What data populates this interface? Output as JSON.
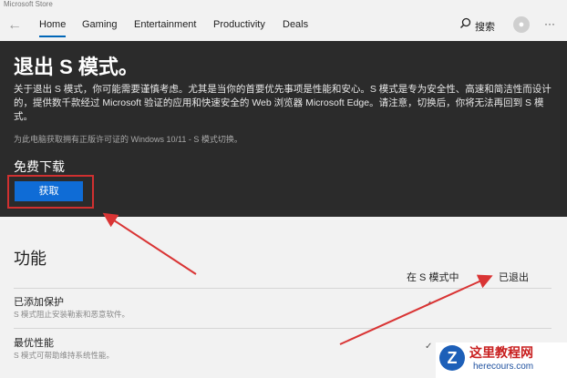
{
  "window": {
    "title": "Microsoft Store"
  },
  "nav": {
    "items": [
      {
        "label": "Home",
        "active": true
      },
      {
        "label": "Gaming"
      },
      {
        "label": "Entertainment"
      },
      {
        "label": "Productivity"
      },
      {
        "label": "Deals"
      }
    ],
    "search_label": "搜索",
    "more_label": "···",
    "icons": [
      "back-arrow-icon",
      "search-icon",
      "user-avatar-icon",
      "more-icon"
    ]
  },
  "hero": {
    "title": "退出 S 模式。",
    "description": "关于退出 S 模式，你可能需要谨慎考虑。尤其是当你的首要优先事项是性能和安心。S 模式是专为安全性、高速和简洁性而设计的，提供数千款经过 Microsoft 验证的应用和快速安全的 Web 浏览器 Microsoft Edge。请注意，切换后，你将无法再回到 S 模式。",
    "note": "为此电脑获取拥有正版许可证的 Windows 10/11 - S 模式切换。",
    "free_label": "免费下载",
    "get_button": "获取"
  },
  "features": {
    "title": "功能",
    "columns": [
      "在 S 模式中",
      "已退出"
    ],
    "rows": [
      {
        "title": "已添加保护",
        "subtitle": "S 模式阻止安装勒索和恶意软件。",
        "in_s_mode": true,
        "exited": false
      },
      {
        "title": "最优性能",
        "subtitle": "S 模式可帮助维持系统性能。",
        "in_s_mode": true,
        "exited": false
      }
    ]
  },
  "annotations": {
    "color": "#d93434",
    "highlight": "get-button"
  },
  "watermark": {
    "logo_letter": "Z",
    "name": "这里教程网",
    "url": "herecours.com"
  },
  "colors": {
    "accent": "#0f6cd6",
    "hero_bg": "#2b2b2b",
    "page_bg": "#f2f2f2"
  }
}
